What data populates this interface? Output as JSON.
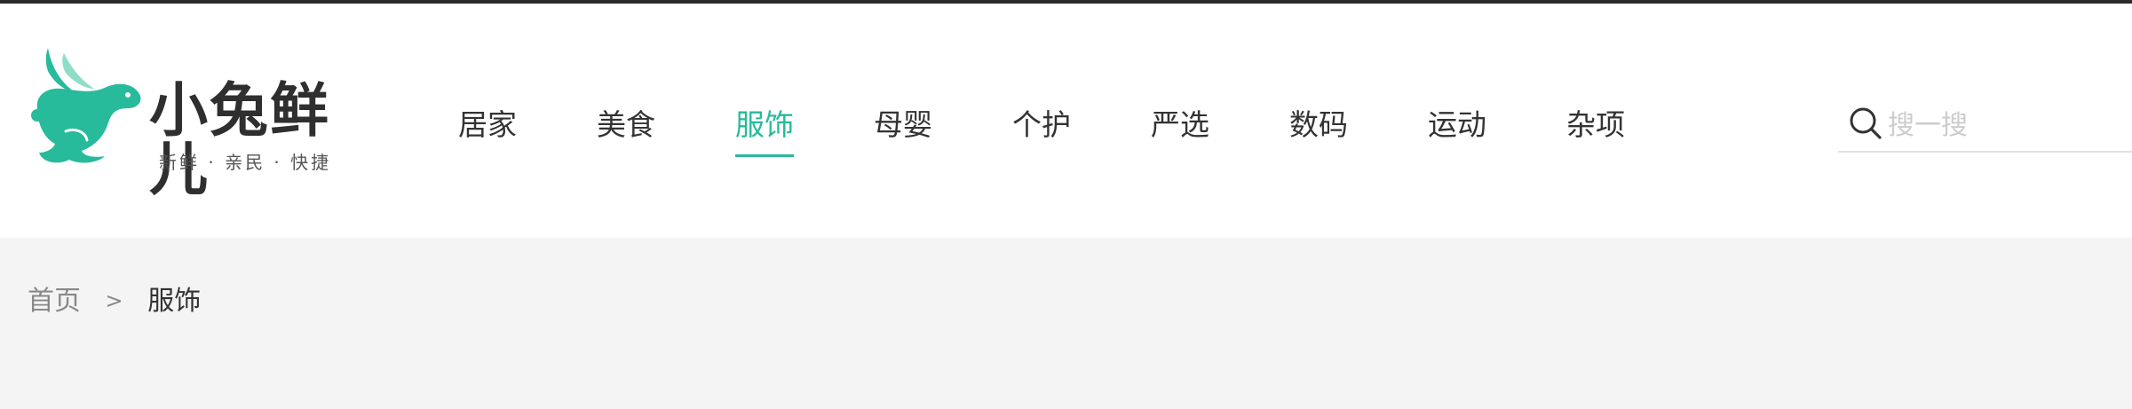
{
  "brand": {
    "name": "小兔鲜儿",
    "slogan": "新鲜 · 亲民 · 快捷",
    "color": "#27ba9b"
  },
  "nav": {
    "items": [
      {
        "label": "居家"
      },
      {
        "label": "美食"
      },
      {
        "label": "服饰",
        "active": true
      },
      {
        "label": "母婴"
      },
      {
        "label": "个护"
      },
      {
        "label": "严选"
      },
      {
        "label": "数码"
      },
      {
        "label": "运动"
      },
      {
        "label": "杂项"
      }
    ],
    "active_color": "#27ba9b"
  },
  "search": {
    "placeholder": "搜一搜",
    "value": "",
    "icon": "search-icon"
  },
  "breadcrumb": {
    "home": "首页",
    "separator": ">",
    "current": "服饰"
  }
}
